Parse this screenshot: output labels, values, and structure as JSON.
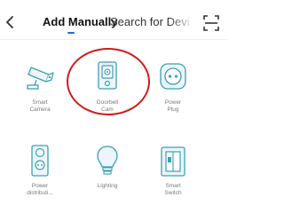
{
  "header": {
    "tabs": [
      {
        "label": "Add Manually",
        "active": true
      },
      {
        "label": "Search for Devi",
        "active": false
      }
    ]
  },
  "accent_color": "#1f6fd1",
  "highlight_color": "#d11b1b",
  "devices": [
    {
      "label_line1": "Smart",
      "label_line2": "Camera",
      "icon": "smart-camera-icon"
    },
    {
      "label_line1": "Doorbell",
      "label_line2": "Cam",
      "icon": "doorbell-cam-icon",
      "highlighted": true
    },
    {
      "label_line1": "Power",
      "label_line2": "Plug",
      "icon": "power-plug-icon"
    },
    {
      "label_line1": "Power",
      "label_line2": "distributi...",
      "icon": "power-distribution-icon"
    },
    {
      "label_line1": "Lighting",
      "label_line2": "",
      "icon": "light-bulb-icon"
    },
    {
      "label_line1": "Smart",
      "label_line2": "Switch",
      "icon": "smart-switch-icon"
    }
  ]
}
